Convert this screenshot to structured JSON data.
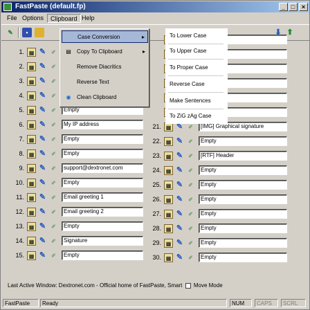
{
  "window": {
    "title": "FastPaste (default.fp)",
    "controls": {
      "minimize": "_",
      "maximize": "□",
      "close": "×"
    }
  },
  "menu": {
    "file": "File",
    "options": "Options",
    "clipboard": "Clipboard",
    "help": "Help"
  },
  "clipboard_menu": [
    {
      "label": "Case Conversion",
      "icon": "",
      "submenu": true
    },
    {
      "label": "Copy To Clipboard",
      "icon": "copy-icon",
      "submenu": true
    },
    {
      "label": "Remove Diacritics",
      "icon": "",
      "submenu": false
    },
    {
      "label": "Reverse Text",
      "icon": "",
      "submenu": false
    },
    {
      "label": "Clean Clipboard",
      "icon": "clean-icon",
      "submenu": false
    }
  ],
  "case_submenu": [
    "To Lower Case",
    "To Upper Case",
    "To Proper Case",
    "Reverse Case",
    "Make Sentences",
    "To ZiG zAg Case"
  ],
  "left_rows": [
    {
      "num": "1.",
      "value": ""
    },
    {
      "num": "2.",
      "value": ""
    },
    {
      "num": "3.",
      "value": ""
    },
    {
      "num": "4.",
      "value": ""
    },
    {
      "num": "5.",
      "value": "Empty"
    },
    {
      "num": "6.",
      "value": "My IP address"
    },
    {
      "num": "7.",
      "value": "Empty"
    },
    {
      "num": "8.",
      "value": "Empty"
    },
    {
      "num": "9.",
      "value": "support@dextronet.com"
    },
    {
      "num": "10.",
      "value": "Empty"
    },
    {
      "num": "11.",
      "value": "Email greeting 1"
    },
    {
      "num": "12.",
      "value": "Email greeting 2"
    },
    {
      "num": "13.",
      "value": "Empty"
    },
    {
      "num": "14.",
      "value": "Signature"
    },
    {
      "num": "15.",
      "value": "Empty"
    }
  ],
  "right_rows": [
    {
      "num": "",
      "value": ""
    },
    {
      "num": "",
      "value": ""
    },
    {
      "num": "",
      "value": "name"
    },
    {
      "num": "",
      "value": "sword"
    },
    {
      "num": "",
      "value": ""
    },
    {
      "num": "",
      "value": "ogo"
    },
    {
      "num": "21.",
      "value": "[IMG] Graphical signature"
    },
    {
      "num": "22.",
      "value": "Empty"
    },
    {
      "num": "23.",
      "value": "[RTF] Header"
    },
    {
      "num": "24.",
      "value": "Empty"
    },
    {
      "num": "25.",
      "value": "Empty"
    },
    {
      "num": "26.",
      "value": "Empty"
    },
    {
      "num": "27.",
      "value": "Empty"
    },
    {
      "num": "28.",
      "value": "Empty"
    },
    {
      "num": "29.",
      "value": "Empty"
    },
    {
      "num": "30.",
      "value": "Empty"
    }
  ],
  "status": {
    "last_active": "Last Active Window: Dextronet.com - Official home of FastPaste, Smart",
    "move_mode": "Move Mode",
    "panel_app": "FastPaste",
    "panel_state": "Ready",
    "num": "NUM",
    "caps": "CAPS",
    "scrl": "SCRL"
  },
  "colors": {
    "title_start": "#0a246a",
    "title_end": "#a6caf0",
    "highlight": "#a6b8d8"
  }
}
